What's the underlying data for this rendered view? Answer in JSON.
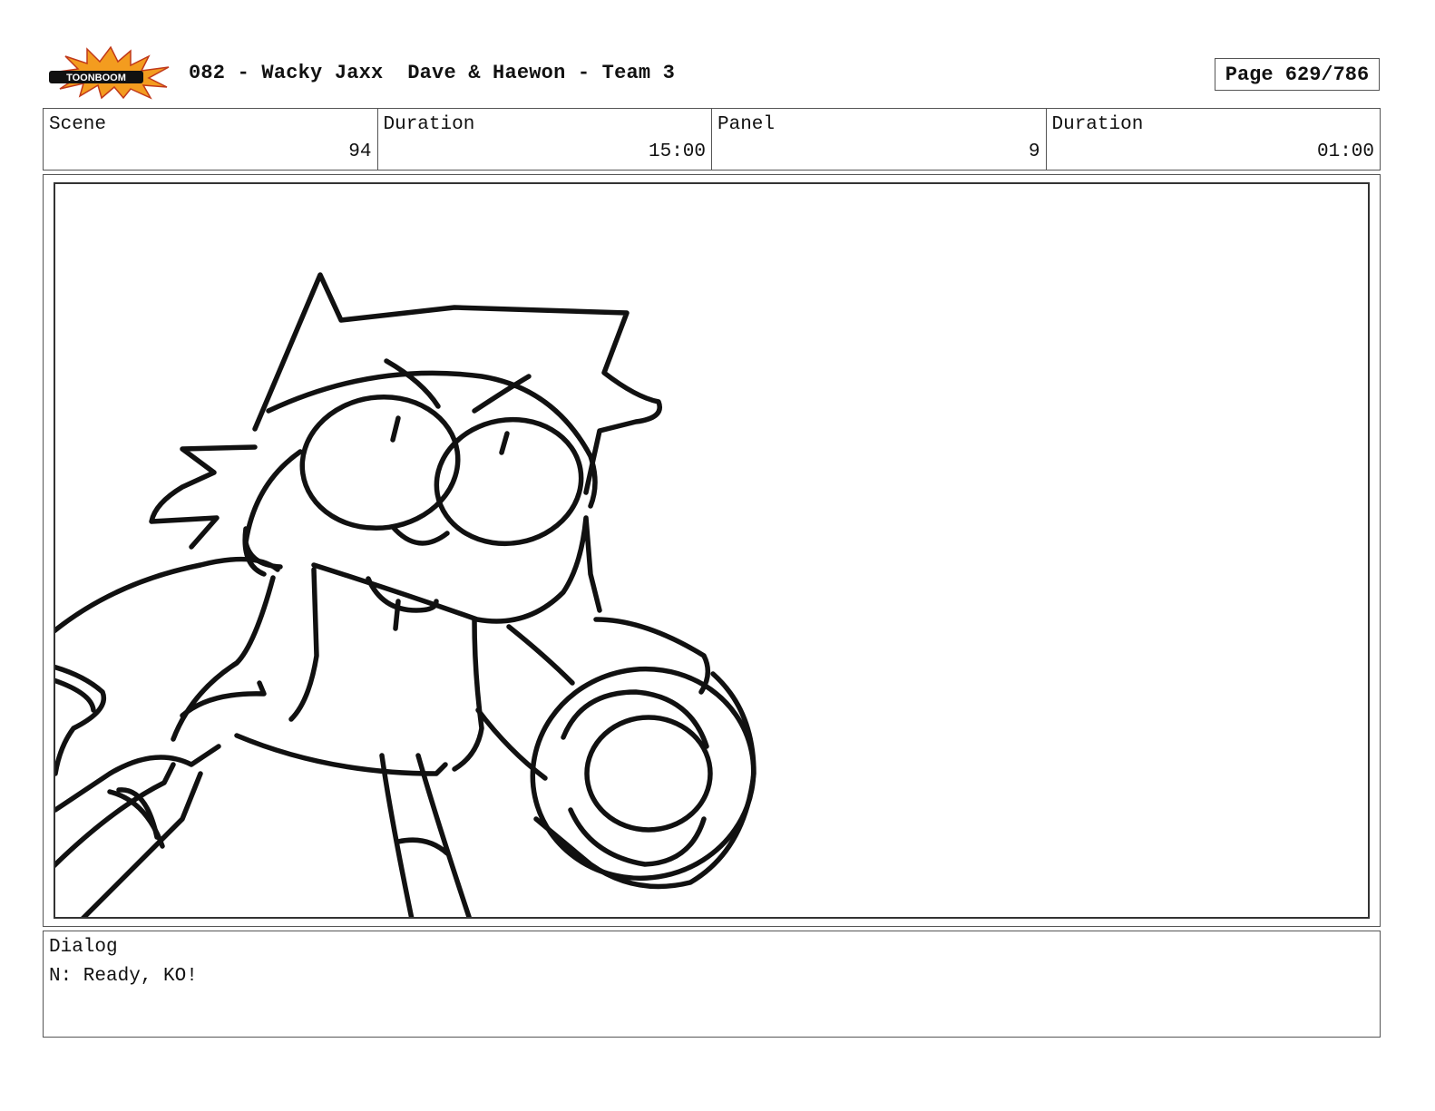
{
  "header": {
    "logo_text": "TOONBOOM",
    "title": "082 - Wacky Jaxx  Dave & Haewon - Team 3",
    "page": "Page 629/786"
  },
  "info": {
    "scene_label": "Scene",
    "scene_value": "94",
    "scene_duration_label": "Duration",
    "scene_duration_value": "15:00",
    "panel_label": "Panel",
    "panel_value": "9",
    "panel_duration_label": "Duration",
    "panel_duration_value": "01:00"
  },
  "dialog": {
    "label": "Dialog",
    "text": "N: Ready, KO!"
  },
  "colors": {
    "logo_burst": "#f39c1f",
    "logo_outline": "#c0391b",
    "logo_band": "#111111"
  }
}
